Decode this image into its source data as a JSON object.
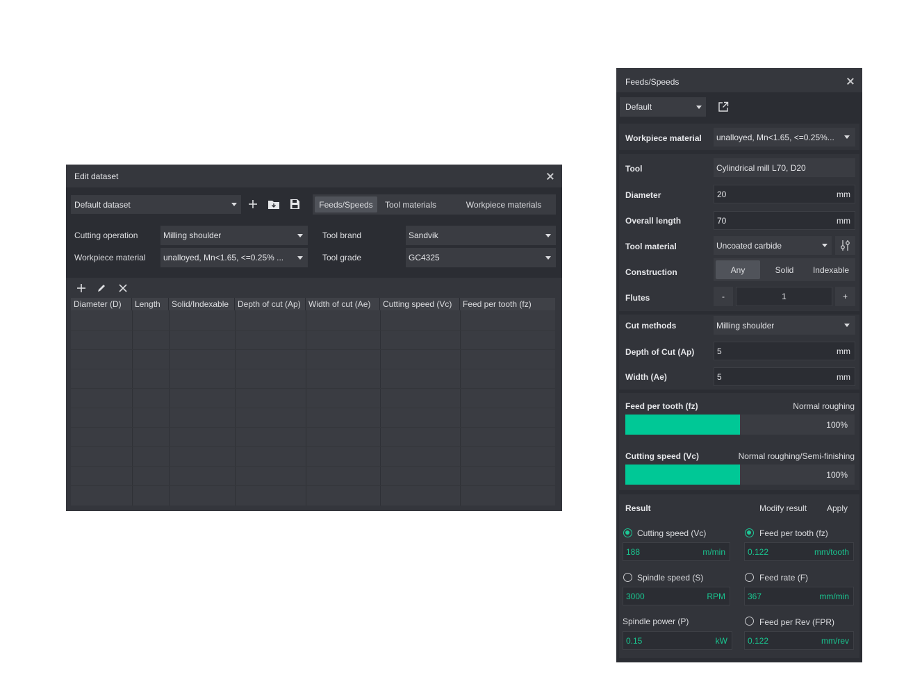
{
  "edit_dataset": {
    "title": "Edit dataset",
    "dataset_select": "Default dataset",
    "tabs": [
      "Feeds/Speeds",
      "Tool materials",
      "Workpiece materials"
    ],
    "active_tab": "Feeds/Speeds",
    "filters": {
      "cutting_operation_label": "Cutting operation",
      "cutting_operation_value": "Milling shoulder",
      "workpiece_material_label": "Workpiece material",
      "workpiece_material_value": "unalloyed,  Mn<1.65, <=0.25% ...",
      "tool_brand_label": "Tool brand",
      "tool_brand_value": "Sandvik",
      "tool_grade_label": "Tool grade",
      "tool_grade_value": "GC4325"
    },
    "table": {
      "columns": [
        "Diameter (D)",
        "Length",
        "Solid/Indexable",
        "Depth of cut (Ap)",
        "Width of cut (Ae)",
        "Cutting speed (Vc)",
        "Feed per tooth (fz)"
      ],
      "rows": []
    }
  },
  "feeds_speeds": {
    "title": "Feeds/Speeds",
    "preset": "Default",
    "workpiece_material": {
      "label": "Workpiece material",
      "value": "unalloyed,  Mn<1.65, <=0.25%..."
    },
    "tool": {
      "label": "Tool",
      "value": "Cylindrical mill L70, D20"
    },
    "diameter": {
      "label": "Diameter",
      "value": "20",
      "unit": "mm"
    },
    "overall_length": {
      "label": "Overall length",
      "value": "70",
      "unit": "mm"
    },
    "tool_material": {
      "label": "Tool material",
      "value": "Uncoated carbide"
    },
    "construction": {
      "label": "Construction",
      "options": [
        "Any",
        "Solid",
        "Indexable"
      ],
      "selected": "Any"
    },
    "flutes": {
      "label": "Flutes",
      "value": "1",
      "minus": "-",
      "plus": "+"
    },
    "cut_methods": {
      "label": "Cut methods",
      "value": "Milling shoulder"
    },
    "depth_of_cut": {
      "label": "Depth of Cut (Ap)",
      "value": "5",
      "unit": "mm"
    },
    "width": {
      "label": "Width (Ae)",
      "value": "5",
      "unit": "mm"
    },
    "feed_per_tooth_slider": {
      "label": "Feed per tooth (fz)",
      "mode": "Normal roughing",
      "percent_text": "100%",
      "level": 0.5
    },
    "cutting_speed_slider": {
      "label": "Cutting speed (Vc)",
      "mode": "Normal roughing/Semi-finishing",
      "percent_text": "100%",
      "level": 0.5
    },
    "result": {
      "label": "Result",
      "modify": "Modify result",
      "apply": "Apply",
      "cutting_speed": {
        "label": "Cutting speed (Vc)",
        "value": "188",
        "unit": "m/min",
        "selected": true
      },
      "feed_per_tooth": {
        "label": "Feed per tooth (fz)",
        "value": "0.122",
        "unit": "mm/tooth",
        "selected": true
      },
      "spindle_speed": {
        "label": "Spindle speed (S)",
        "value": "3000",
        "unit": "RPM",
        "selected": false
      },
      "feed_rate": {
        "label": "Feed rate (F)",
        "value": "367",
        "unit": "mm/min",
        "selected": false
      },
      "spindle_power": {
        "label": "Spindle power (P)",
        "value": "0.15",
        "unit": "kW"
      },
      "feed_per_rev": {
        "label": "Feed per Rev (FPR)",
        "value": "0.122",
        "unit": "mm/rev",
        "selected": false
      }
    }
  },
  "colors": {
    "accent": "#00c896",
    "panel_bg": "#2b2d33",
    "section_bg": "#32343a"
  }
}
